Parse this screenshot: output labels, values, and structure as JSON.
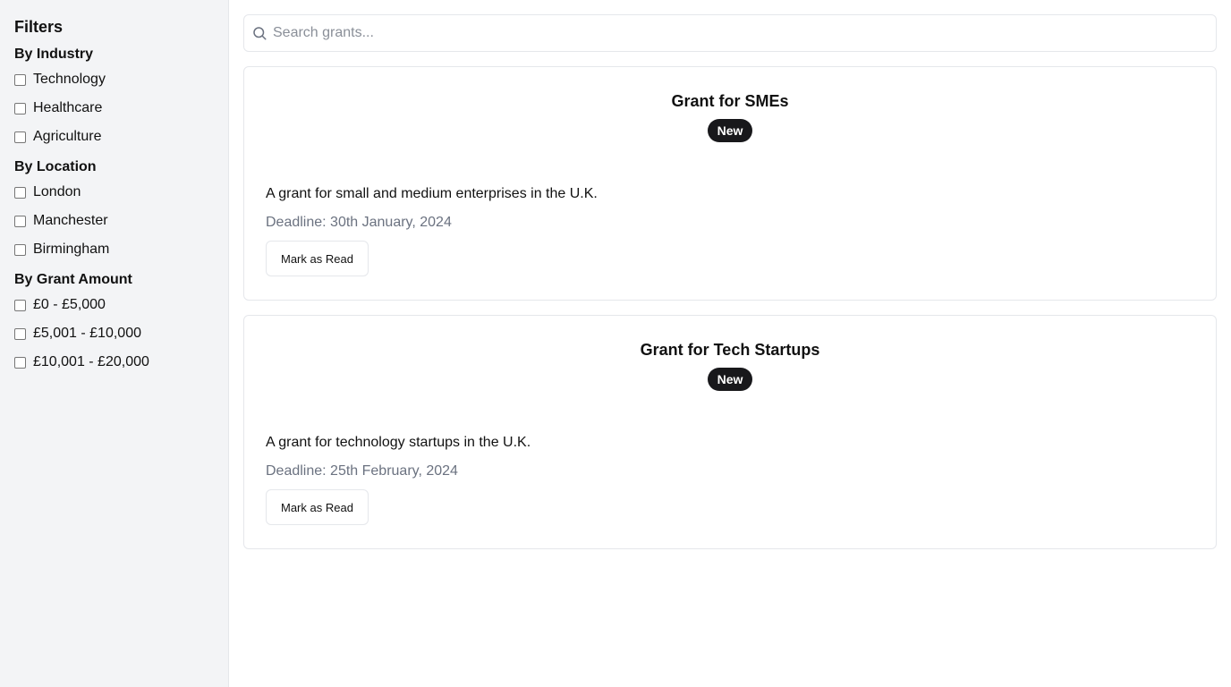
{
  "sidebar": {
    "title": "Filters",
    "groups": [
      {
        "heading": "By Industry",
        "options": [
          "Technology",
          "Healthcare",
          "Agriculture"
        ]
      },
      {
        "heading": "By Location",
        "options": [
          "London",
          "Manchester",
          "Birmingham"
        ]
      },
      {
        "heading": "By Grant Amount",
        "options": [
          "£0 - £5,000",
          "£5,001 - £10,000",
          "£10,001 - £20,000"
        ]
      }
    ]
  },
  "search": {
    "placeholder": "Search grants...",
    "value": "",
    "icon": "search-icon"
  },
  "grants": [
    {
      "title": "Grant for SMEs",
      "badge": "New",
      "description": "A grant for small and medium enterprises in the U.K.",
      "deadline": "Deadline: 30th January, 2024",
      "button_label": "Mark as Read"
    },
    {
      "title": "Grant for Tech Startups",
      "badge": "New",
      "description": "A grant for technology startups in the U.K.",
      "deadline": "Deadline: 25th February, 2024",
      "button_label": "Mark as Read"
    }
  ],
  "colors": {
    "sidebar_bg": "#f3f4f6",
    "badge_bg": "#18181b",
    "muted_text": "#6b7280",
    "border": "#e5e7eb"
  }
}
